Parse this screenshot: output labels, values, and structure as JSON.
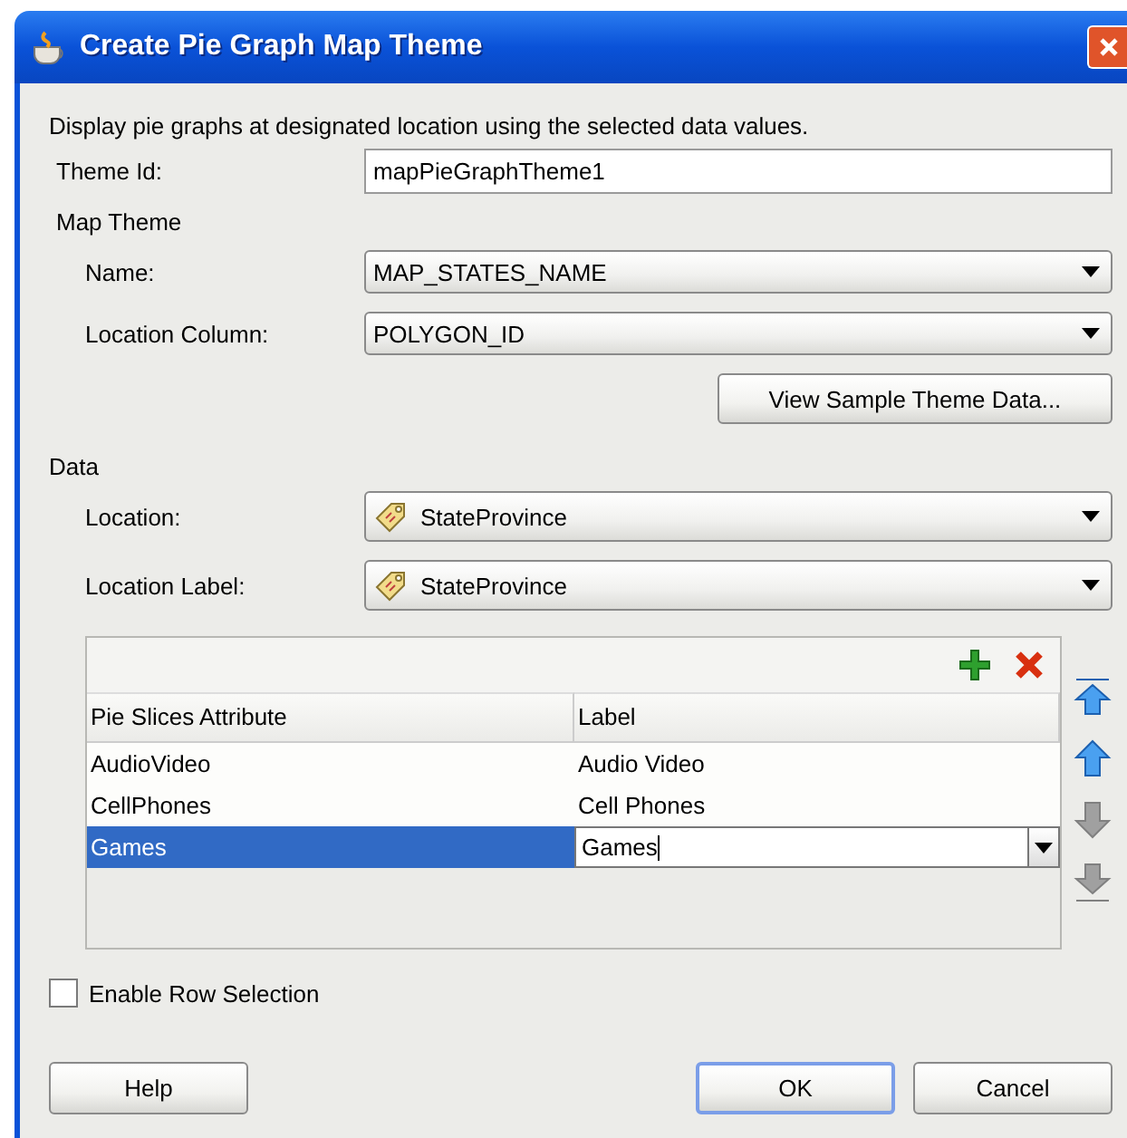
{
  "window": {
    "title": "Create Pie Graph Map Theme"
  },
  "description": "Display pie graphs at designated location using the selected data values.",
  "theme_id": {
    "label": "Theme Id:",
    "value": "mapPieGraphTheme1"
  },
  "map_theme": {
    "heading": "Map Theme",
    "fields": [
      {
        "label": "Name:",
        "value": "MAP_STATES_NAME"
      },
      {
        "label": "Location Column:",
        "value": "POLYGON_ID"
      }
    ],
    "view_button": "View Sample Theme Data..."
  },
  "data": {
    "heading": "Data",
    "fields": [
      {
        "label": "Location:",
        "value": "StateProvince"
      },
      {
        "label": "Location Label:",
        "value": "StateProvince"
      }
    ]
  },
  "table": {
    "columns": [
      "Pie Slices Attribute",
      "Label"
    ],
    "rows": [
      {
        "attribute": "AudioVideo",
        "label": "Audio Video",
        "selected": false
      },
      {
        "attribute": "CellPhones",
        "label": "Cell Phones",
        "selected": false
      },
      {
        "attribute": "Games",
        "label": "Games",
        "selected": true
      }
    ]
  },
  "move_buttons": [
    {
      "kind": "top",
      "disabled": false
    },
    {
      "kind": "up",
      "disabled": false
    },
    {
      "kind": "down",
      "disabled": true
    },
    {
      "kind": "bottom",
      "disabled": true
    }
  ],
  "enable_row_selection": {
    "label": "Enable Row Selection",
    "checked": false
  },
  "help_button": "Help",
  "buttons": [
    {
      "label": "OK",
      "default": true
    },
    {
      "label": "Cancel",
      "default": false
    }
  ]
}
